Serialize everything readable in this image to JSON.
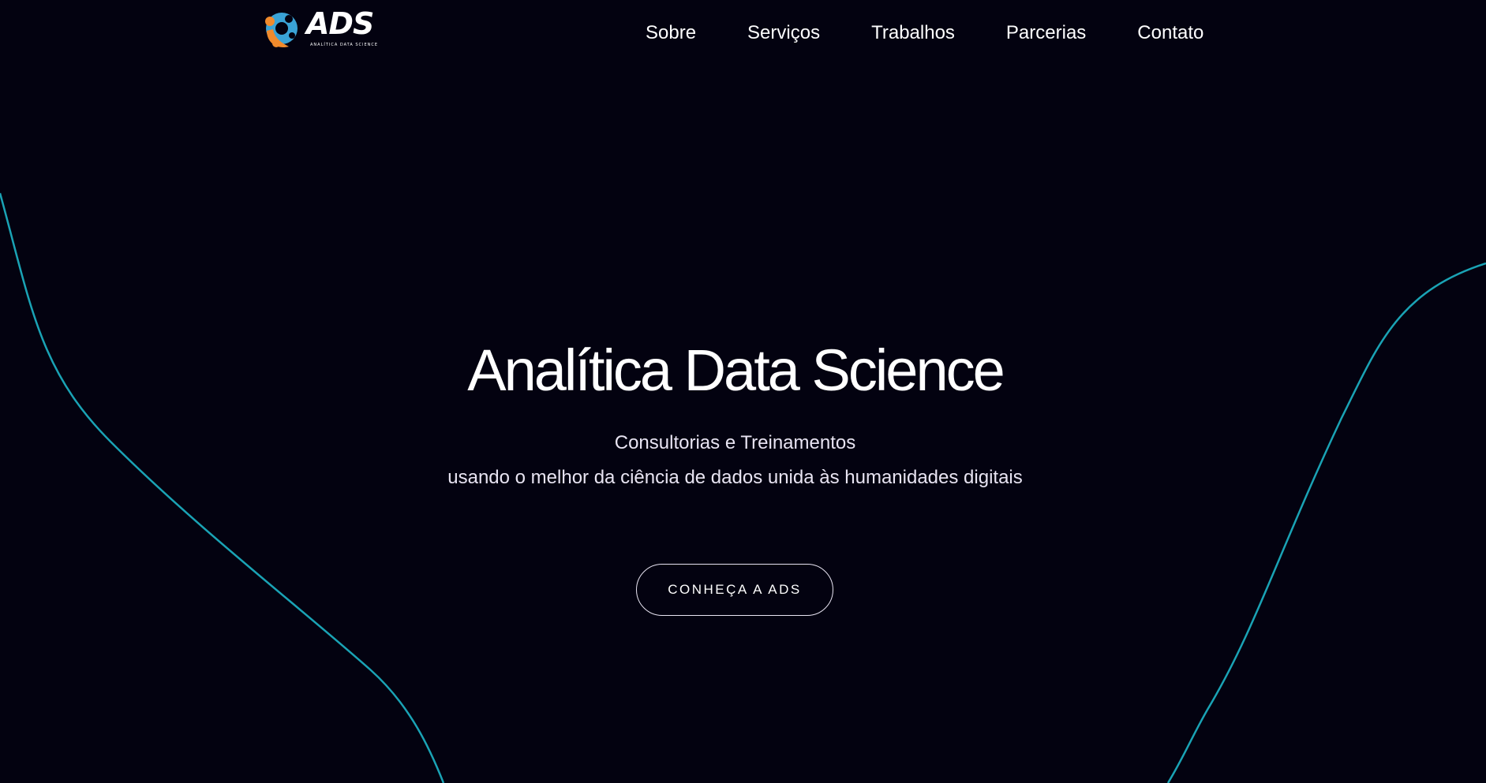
{
  "navbar": {
    "logo": {
      "text": "ADS",
      "subtext": "ANALÍTICA DATA SCIENCE",
      "icon": "ads-logo-icon"
    },
    "links": [
      {
        "label": "Sobre"
      },
      {
        "label": "Serviços"
      },
      {
        "label": "Trabalhos"
      },
      {
        "label": "Parcerias"
      },
      {
        "label": "Contato"
      }
    ]
  },
  "hero": {
    "title": "Analítica Data Science",
    "subtitle_line1": "Consultorias e Treinamentos",
    "subtitle_line2": "usando o melhor da ciência de dados unida às humanidades digitais",
    "cta_label": "CONHEÇA A ADS"
  },
  "colors": {
    "background": "#030210",
    "accent_curve": "#1aa3b5",
    "logo_blue": "#3aa3d6",
    "logo_orange": "#f08a2c",
    "text": "#ffffff"
  }
}
